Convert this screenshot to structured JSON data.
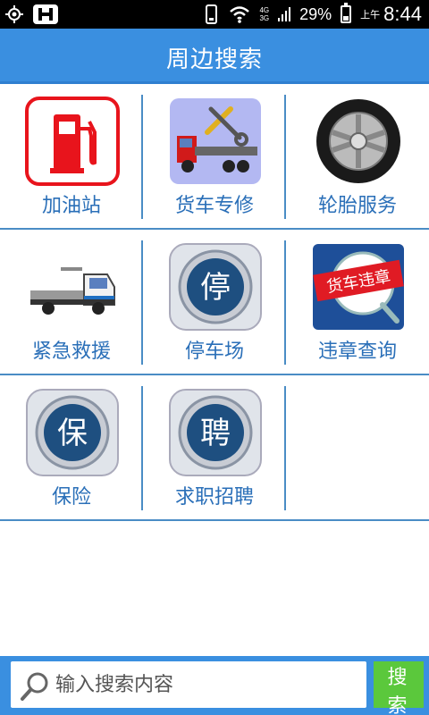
{
  "status_bar": {
    "network_top": "4G",
    "network_bottom": "3G",
    "battery_percent": "29%",
    "am_pm": "上午",
    "time": "8:44"
  },
  "header": {
    "title": "周边搜索"
  },
  "grid": {
    "items": [
      {
        "label": "加油站",
        "icon": "gas-station-icon"
      },
      {
        "label": "货车专修",
        "icon": "truck-repair-icon"
      },
      {
        "label": "轮胎服务",
        "icon": "tire-icon"
      },
      {
        "label": "紧急救援",
        "icon": "tow-truck-icon"
      },
      {
        "label": "停车场",
        "icon": "parking-icon",
        "glyph": "停"
      },
      {
        "label": "违章查询",
        "icon": "violation-query-icon",
        "glyph": "货车违章"
      },
      {
        "label": "保险",
        "icon": "insurance-icon",
        "glyph": "保"
      },
      {
        "label": "求职招聘",
        "icon": "recruitment-icon",
        "glyph": "聘"
      }
    ]
  },
  "search": {
    "placeholder": "输入搜索内容",
    "button_label": "搜 索"
  },
  "colors": {
    "accent": "#3a8fe0",
    "label_blue": "#2a6fb8",
    "search_button": "#5bc83c",
    "gas_red": "#e8141c"
  }
}
